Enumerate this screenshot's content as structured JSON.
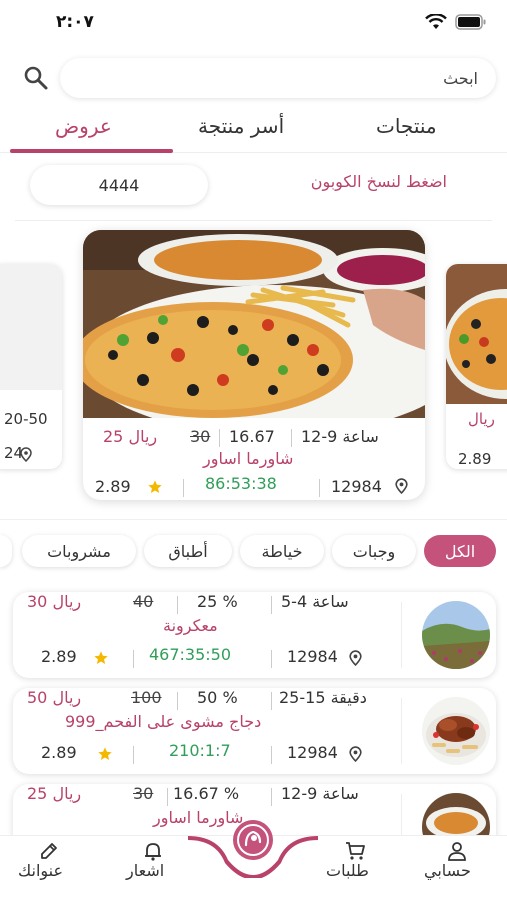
{
  "status": {
    "time": "٢:٠٧"
  },
  "search": {
    "placeholder": "ابحث"
  },
  "top_tabs": [
    {
      "label": "منتجات"
    },
    {
      "label": "أسر منتجة"
    },
    {
      "label": "عروض"
    }
  ],
  "coupon": {
    "label": "اضغط لنسخ الكوبون",
    "code": "4444"
  },
  "featured": {
    "time": "12-9 ساعة",
    "discount": "16.67",
    "old_price": "30",
    "new_price": "25 ريال",
    "name": "شاورما اساور",
    "code": "12984",
    "countdown": "86:53:38",
    "rating": "2.89"
  },
  "side_left": {
    "time": "20-50",
    "code": "24"
  },
  "side_right": {
    "price": "ريال",
    "rating": "2.89"
  },
  "categories": [
    {
      "label": "الكل"
    },
    {
      "label": "وجبات"
    },
    {
      "label": "خياطة"
    },
    {
      "label": "أطباق"
    },
    {
      "label": "مشروبات"
    }
  ],
  "items": [
    {
      "time": "5-4 ساعة",
      "discount": "25 %",
      "old_price": "40",
      "new_price": "30 ريال",
      "name": "معكرونة",
      "code": "12984",
      "countdown": "467:35:50",
      "rating": "2.89"
    },
    {
      "time": "25-15 دقيقة",
      "discount": "50 %",
      "old_price": "100",
      "new_price": "50 ريال",
      "name": "دجاج مشوى على الفحم_999",
      "code": "12984",
      "countdown": "210:1:7",
      "rating": "2.89"
    },
    {
      "time": "12-9 ساعة",
      "discount": "16.67 %",
      "old_price": "30",
      "new_price": "25 ريال",
      "name": "شاورما اساور",
      "code": "",
      "countdown": "",
      "rating": ""
    }
  ],
  "nav": {
    "account": "حسابي",
    "orders": "طلبات",
    "notify": "اشعار",
    "address": "عنوانك"
  },
  "colors": {
    "accent": "#b8426a",
    "countdown": "#2f9e58",
    "star": "#f5b800"
  }
}
